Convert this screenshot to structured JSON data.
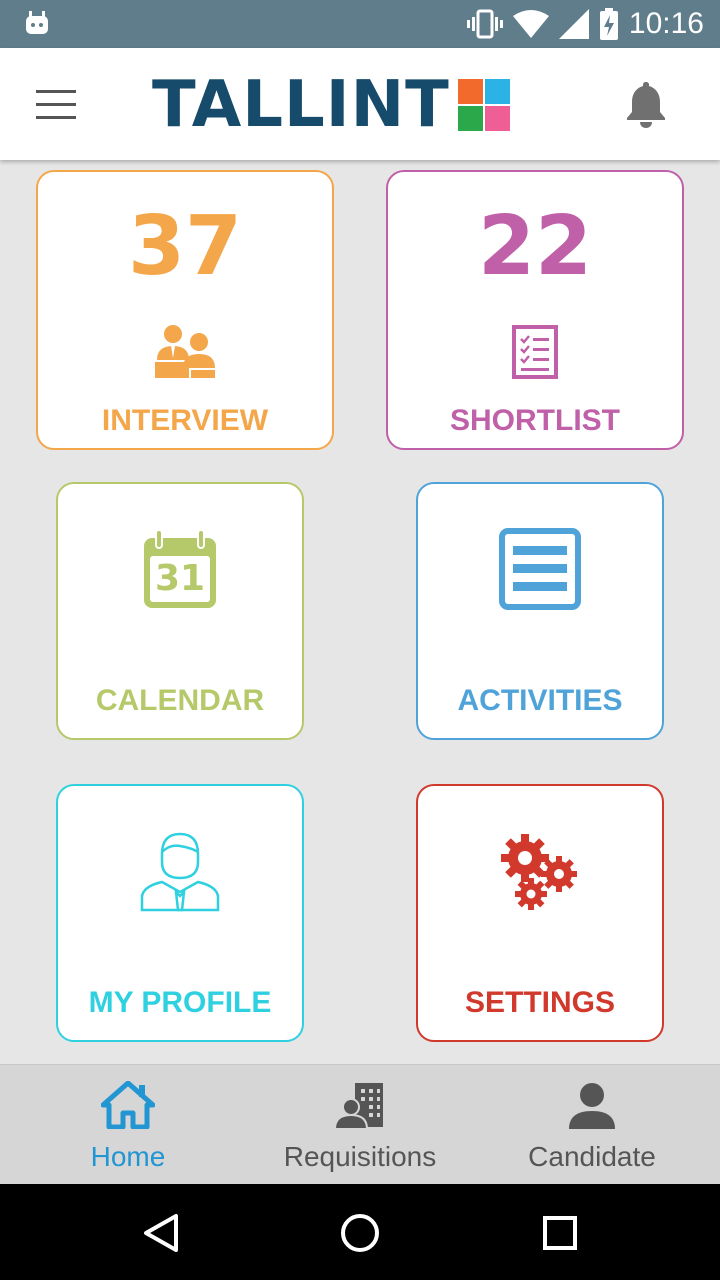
{
  "status_bar": {
    "time": "10:16"
  },
  "app_bar": {
    "brand": "TALLINT"
  },
  "tiles": {
    "interview": {
      "count": "37",
      "label": "INTERVIEW",
      "color": "#f4a64a"
    },
    "shortlist": {
      "count": "22",
      "label": "SHORTLIST",
      "color": "#c060a8"
    },
    "calendar": {
      "day": "31",
      "label": "CALENDAR",
      "color": "#b5c96a"
    },
    "activities": {
      "label": "ACTIVITIES",
      "color": "#4fa3d9"
    },
    "profile": {
      "label": "MY PROFILE",
      "color": "#2fd0e0"
    },
    "settings": {
      "label": "SETTINGS",
      "color": "#d0392b"
    }
  },
  "bottom_nav": {
    "items": [
      {
        "label": "Home",
        "icon": "home-icon",
        "active": true
      },
      {
        "label": "Requisitions",
        "icon": "building-user-icon",
        "active": false
      },
      {
        "label": "Candidate",
        "icon": "person-icon",
        "active": false
      }
    ],
    "active_color": "#2196d3",
    "inactive_color": "#555555"
  },
  "brand_colors": {
    "navy": "#174b6b",
    "orange": "#f26b2d",
    "sky": "#2bb3e6",
    "green": "#2ba84a",
    "pink": "#ef5f96"
  }
}
